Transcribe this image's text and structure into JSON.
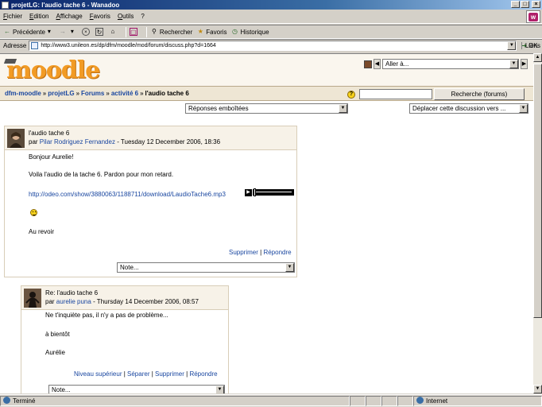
{
  "window": {
    "title": "projetLG: l'audio tache 6 - Wanadoo",
    "buttons": {
      "minimize": "_",
      "maximize": "□",
      "close": "×"
    }
  },
  "menu": [
    "Fichier",
    "Edition",
    "Affichage",
    "Favoris",
    "Outils",
    "?"
  ],
  "throbber_letter": "w",
  "toolbar": {
    "back": "Précédente",
    "forward_symbol": "→",
    "search": "Rechercher",
    "favorites": "Favoris",
    "history": "Historique"
  },
  "address": {
    "label": "Adresse",
    "url": "http://www3.unileon.es/dp/dfm/moodle/mod/forum/discuss.php?d=1664",
    "go": "OK",
    "links": "Liens"
  },
  "header": {
    "logo": "moodle",
    "jump_placeholder": "Aller à..."
  },
  "breadcrumb": [
    "dfm-moodle",
    "projetLG",
    "Forums",
    "activité 6",
    "l'audio tache 6"
  ],
  "search": {
    "input_value": "",
    "button_label": "Recherche (forums)",
    "help_symbol": "?"
  },
  "controls": {
    "display_mode": "Réponses emboîtées",
    "move_discussion": "Déplacer cette discussion vers ..."
  },
  "posts": [
    {
      "subject": "l'audio tache 6",
      "by": "par",
      "author": "Pilar Rodriguez Fernandez",
      "date": " - Tuesday 12 December 2006, 18:36",
      "lines": [
        "Bonjour Aurelie!",
        "Voila l'audio de la tache 6. Pardon pour mon retard.",
        "http://odeo.com/show/3880063/1188711/download/LaudioTache6.mp3",
        "Au revoir"
      ],
      "actions": {
        "delete": "Supprimer",
        "sep": " | ",
        "reply": "Répondre"
      },
      "rating": "Note..."
    },
    {
      "subject": "Re: l'audio tache 6",
      "by": "par",
      "author": "aurelie puna",
      "date": " - Thursday 14 December 2006, 08:57",
      "lines": [
        "Ne t'inquiète pas, il n'y a pas de problème...",
        "à bientôt",
        "Aurélie"
      ],
      "actions": {
        "parent": "Niveau supérieur",
        "split": "Séparer",
        "delete": "Supprimer",
        "reply": "Répondre",
        "sep": " | "
      },
      "rating": "Note..."
    }
  ],
  "status": {
    "left": "Terminé",
    "zone": "Internet"
  },
  "colors": {
    "titlebar": "#0a246a",
    "moodle_orange": "#f29b24",
    "link": "#1a47a0",
    "navbar_bg": "#eee6d4"
  }
}
